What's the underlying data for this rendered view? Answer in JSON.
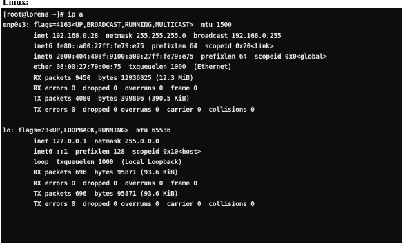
{
  "caption": "Linux:",
  "terminal": {
    "prompt_line": "[root@lorena ~]# ip a",
    "interfaces": [
      {
        "lines": [
          "enp0s3: flags=4163<UP,BROADCAST,RUNNING,MULTICAST>  mtu 1500",
          "        inet 192.168.0.28  netmask 255.255.255.0  broadcast 192.168.0.255",
          "        inet6 fe80::a00:27ff:fe79:e75  prefixlen 64  scopeid 0x20<link>",
          "        inet6 2800:404:408f:9100:a00:27ff:fe79:e75  prefixlen 64  scopeid 0x0<global>",
          "        ether 08:00:27:79:0e:75  txqueuelen 1000  (Ethernet)",
          "        RX packets 9450  bytes 12936825 (12.3 MiB)",
          "        RX errors 0  dropped 0  overruns 0  frame 0",
          "        TX packets 4080  bytes 399806 (390.5 KiB)",
          "        TX errors 0  dropped 0 overruns 0  carrier 0  collisions 0"
        ]
      },
      {
        "lines": [
          "lo: flags=73<UP,LOOPBACK,RUNNING>  mtu 65536",
          "        inet 127.0.0.1  netmask 255.0.0.0",
          "        inet6 ::1  prefixlen 128  scopeid 0x10<host>",
          "        loop  txqueuelen 1000  (Local Loopback)",
          "        RX packets 696  bytes 95871 (93.6 KiB)",
          "        RX errors 0  dropped 0  overruns 0  frame 0",
          "        TX packets 696  bytes 95871 (93.6 KiB)",
          "        TX errors 0  dropped 0 overruns 0  carrier 0  collisions 0"
        ]
      }
    ]
  }
}
